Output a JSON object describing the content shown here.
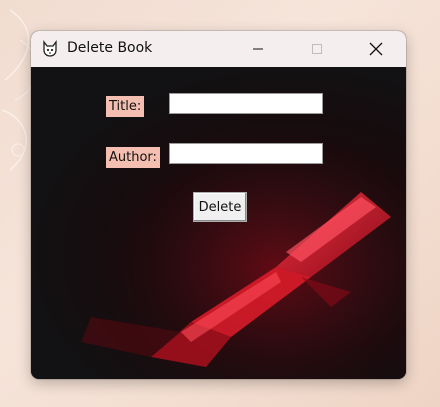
{
  "window": {
    "title": "Delete Book"
  },
  "form": {
    "title_label": "Title:",
    "title_value": "",
    "author_label": "Author:",
    "author_value": "",
    "delete_label": "Delete"
  },
  "icons": {
    "app": "cat-icon",
    "minimize": "minimize-icon",
    "maximize": "maximize-icon",
    "close": "close-icon"
  },
  "colors": {
    "label_bg": "#f4bfb0",
    "titlebar_bg": "#f4eeee",
    "background_accent": "#ff2a3a"
  }
}
